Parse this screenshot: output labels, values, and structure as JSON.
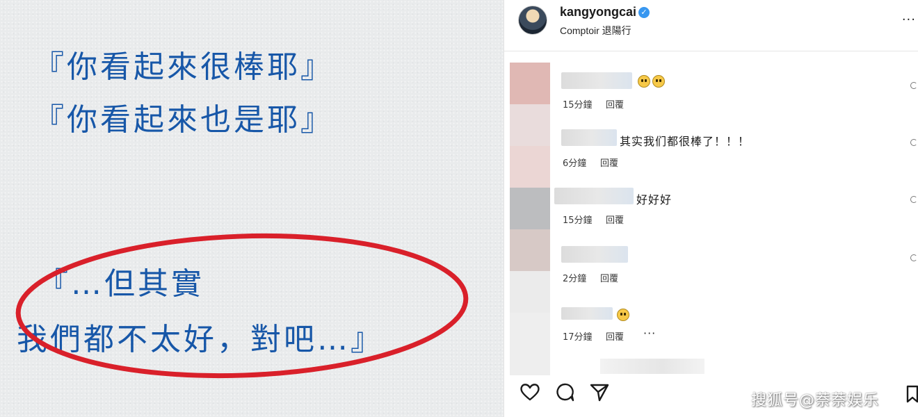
{
  "left_image": {
    "quotes": [
      "『你看起來很棒耶』",
      "『你看起來也是耶』",
      "『…但其實",
      "我們都不太好，對吧…』"
    ],
    "text_color": "#1757a8",
    "highlight_color": "#d9202a"
  },
  "post": {
    "username": "kangyongcai",
    "location": "Comptoir 退陽行",
    "verified_icon": "verified-badge-icon",
    "more_icon": "more-options-icon"
  },
  "comments": [
    {
      "text": "",
      "emoji_count": 2,
      "time": "15分鐘",
      "reply": "回覆",
      "has_more": false
    },
    {
      "text": "其实我们都很棒了！！！",
      "emoji_count": 0,
      "time": "6分鐘",
      "reply": "回覆",
      "has_more": false
    },
    {
      "text": "好好好",
      "emoji_count": 0,
      "time": "15分鐘",
      "reply": "回覆",
      "has_more": false
    },
    {
      "text": "",
      "emoji_count": 0,
      "time": "2分鐘",
      "reply": "回覆",
      "has_more": false
    },
    {
      "text": "",
      "emoji_count": 1,
      "time": "17分鐘",
      "reply": "回覆",
      "has_more": true
    }
  ],
  "actions": {
    "like_icon": "heart-icon",
    "comment_icon": "comment-icon",
    "share_icon": "share-icon",
    "bookmark_icon": "bookmark-icon",
    "watermark": "搜狐号@萘萘娱乐",
    "more_dots": "···"
  }
}
